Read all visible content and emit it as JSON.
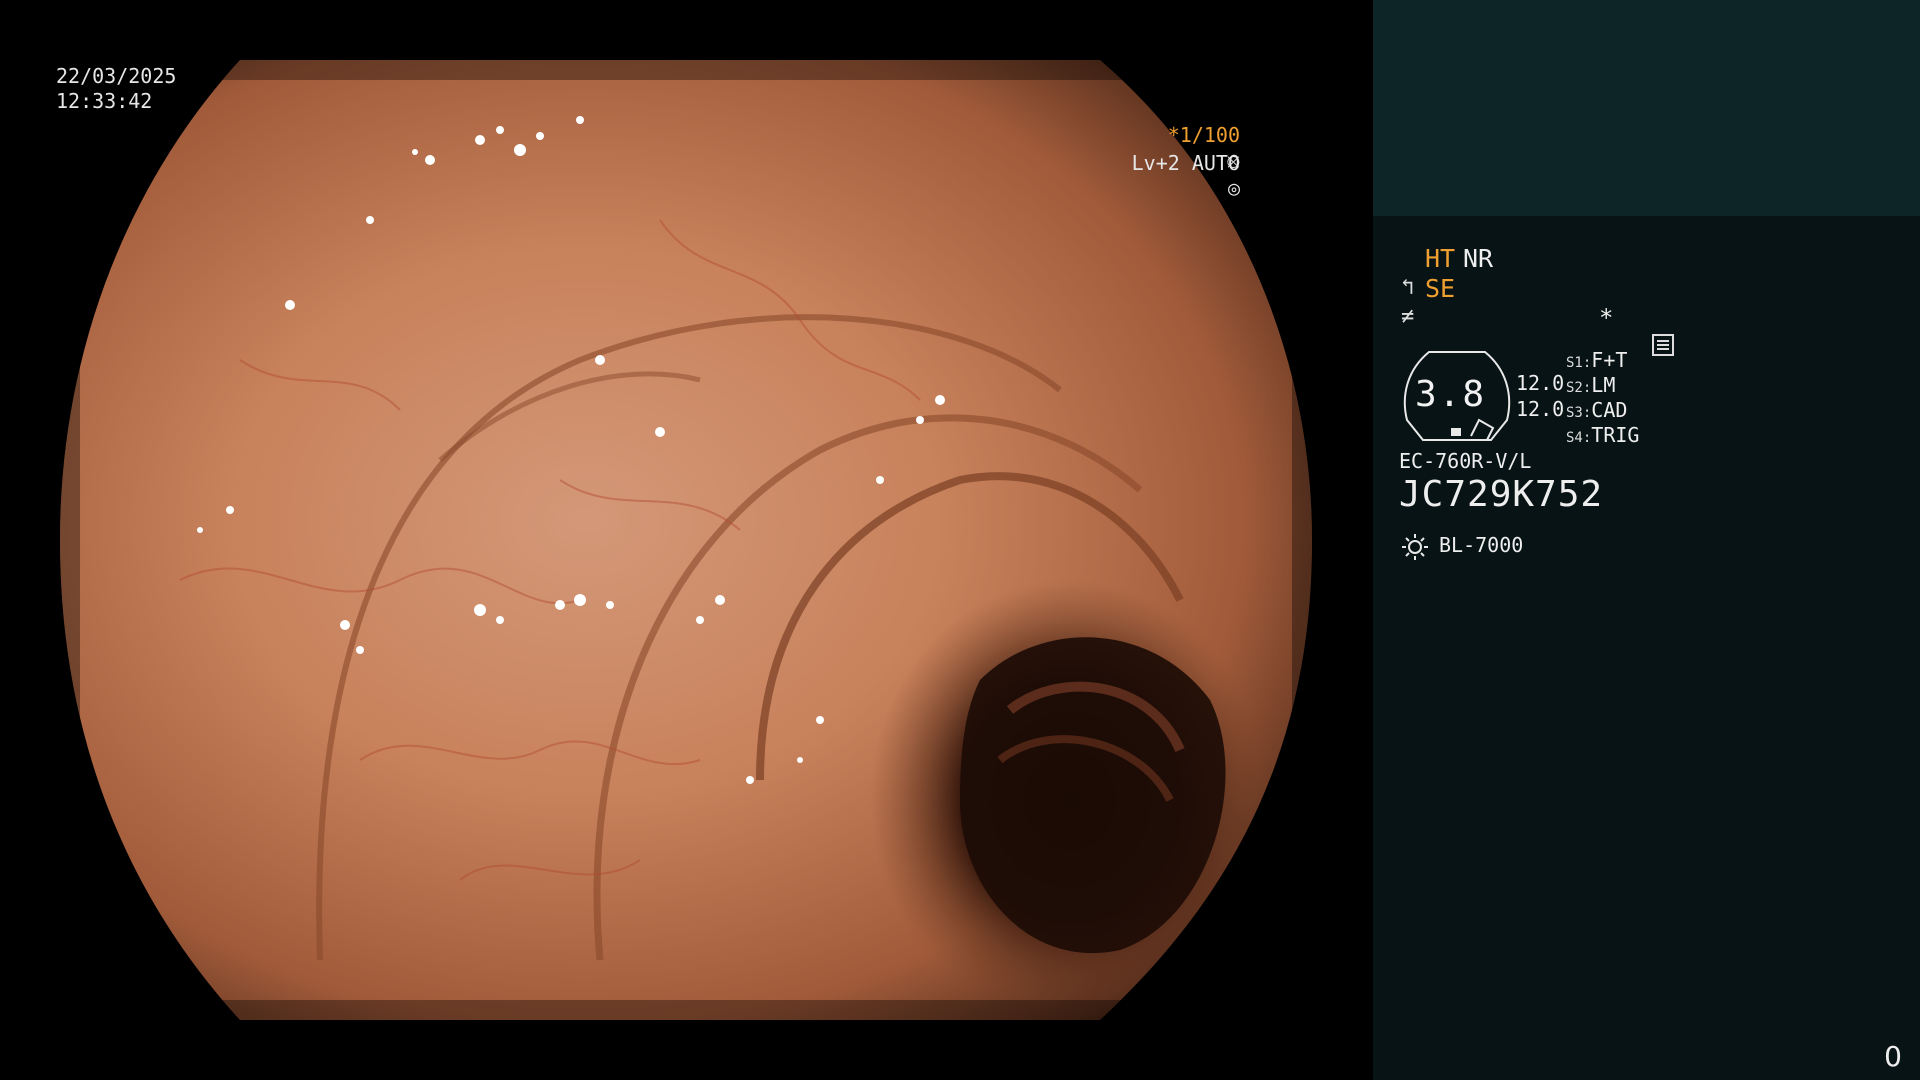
{
  "overlay": {
    "date": "22/03/2025",
    "time": "12:33:42",
    "shutter": "*1/100",
    "shutter_icon": "aperture-icon",
    "level": "Lv+2 AUTO",
    "level_icon": "iris-icon"
  },
  "panel": {
    "ht": "HT",
    "nr": "NR",
    "se": "SE",
    "star": "*",
    "dial_value": "3.8",
    "val1": "12.0",
    "val2": "12.0",
    "switches": [
      {
        "key": "S1:",
        "label": "F+T"
      },
      {
        "key": "S2:",
        "label": "LM"
      },
      {
        "key": "S3:",
        "label": "CAD"
      },
      {
        "key": "S4:",
        "label": "TRIG"
      }
    ],
    "scope_model": "EC-760R-V/L",
    "serial": "JC729K752",
    "light_source": "BL-7000"
  },
  "counter": "0",
  "colors": {
    "accent_orange": "#f0a030",
    "panel_bg": "#071314",
    "panel_top_bg": "#0e2527",
    "tissue": "#c8805a"
  }
}
